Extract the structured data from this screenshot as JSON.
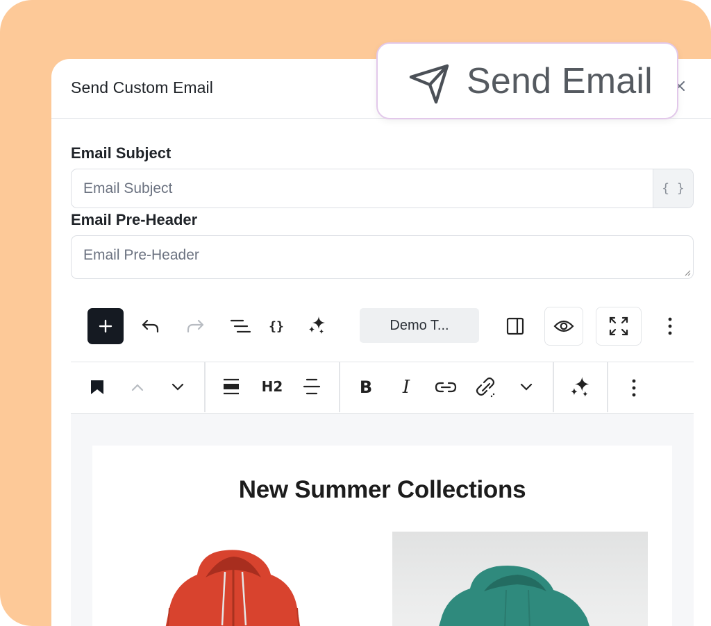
{
  "modal": {
    "title": "Send Custom Email",
    "close_icon": "close-icon"
  },
  "send_badge": {
    "label": "Send Email",
    "icon": "paper-plane-icon"
  },
  "fields": {
    "subject": {
      "label": "Email Subject",
      "placeholder": "Email Subject",
      "value": "",
      "merge_tag_label": "{ }"
    },
    "preheader": {
      "label": "Email Pre-Header",
      "placeholder": "Email Pre-Header",
      "value": ""
    }
  },
  "editor_toolbar": {
    "add_label": "+",
    "template_select": "Demo T...",
    "icons": [
      "plus-icon",
      "undo-icon",
      "redo-icon",
      "list-view-icon",
      "merge-tag-icon",
      "ai-sparkle-icon",
      "sidebar-toggle-icon",
      "preview-eye-icon",
      "fullscreen-icon",
      "more-vertical-icon"
    ]
  },
  "block_toolbar": {
    "heading_level": "H2",
    "bold_label": "B",
    "italic_label": "I",
    "icons": [
      "bookmark-icon",
      "move-up-icon",
      "move-down-icon",
      "align-icon",
      "text-align-center-icon",
      "bold-icon",
      "italic-icon",
      "link-icon",
      "unlink-icon",
      "chevron-down-icon",
      "ai-sparkle-icon",
      "more-vertical-icon"
    ]
  },
  "email_content": {
    "heading": "New Summer Collections",
    "products": [
      {
        "color": "#d8432e",
        "kind": "red hoodie"
      },
      {
        "color": "#2f8a7d",
        "kind": "green hoodie"
      }
    ]
  },
  "colors": {
    "background_accent": "#fdc998",
    "badge_border": "#e2c8ea",
    "primary_button": "#151a22"
  }
}
